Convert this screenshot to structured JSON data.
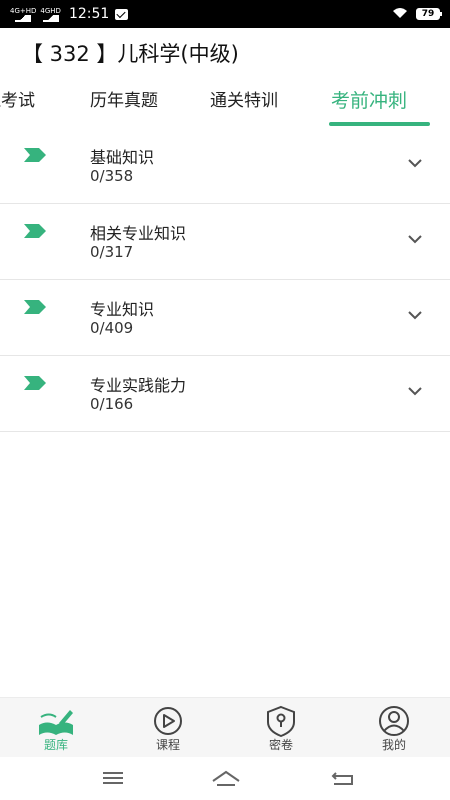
{
  "status_bar": {
    "signal1": "4G+HD",
    "signal2": "4GHD",
    "time": "12:51",
    "battery": "79"
  },
  "header": {
    "title": "【 332 】儿科学(中级)"
  },
  "tabs": [
    {
      "label": "拟考试"
    },
    {
      "label": "历年真题"
    },
    {
      "label": "通关特训"
    },
    {
      "label": "考前冲刺"
    }
  ],
  "sections": [
    {
      "title": "基础知识",
      "count": "0/358"
    },
    {
      "title": "相关专业知识",
      "count": "0/317"
    },
    {
      "title": "专业知识",
      "count": "0/409"
    },
    {
      "title": "专业实践能力",
      "count": "0/166"
    }
  ],
  "bottom_nav": [
    {
      "label": "题库",
      "icon": "book-pen-icon"
    },
    {
      "label": "课程",
      "icon": "play-circle-icon"
    },
    {
      "label": "密卷",
      "icon": "keyhole-shield-icon"
    },
    {
      "label": "我的",
      "icon": "user-circle-icon"
    }
  ],
  "colors": {
    "accent": "#36b37e",
    "text": "#222222",
    "divider": "#e6e6e6"
  }
}
